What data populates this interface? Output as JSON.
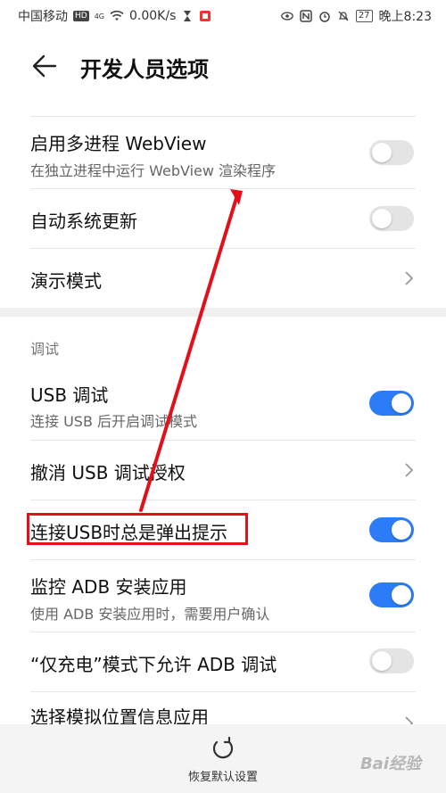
{
  "status_bar": {
    "carrier": "中国移动",
    "hd": "HD",
    "signal": "4G",
    "speed": "0.00K/s",
    "battery": "27",
    "time": "晚上8:23"
  },
  "header": {
    "title": "开发人员选项"
  },
  "items": [
    {
      "title": "启用多进程 WebView",
      "subtitle": "在独立进程中运行 WebView 渲染程序",
      "control": "toggle",
      "on": false
    },
    {
      "title": "自动系统更新",
      "control": "toggle",
      "on": false
    },
    {
      "title": "演示模式",
      "control": "chevron"
    }
  ],
  "debug_section": {
    "title": "调试",
    "items": [
      {
        "title": "USB 调试",
        "subtitle": "连接 USB 后开启调试模式",
        "control": "toggle",
        "on": true
      },
      {
        "title": "撤消 USB 调试授权",
        "control": "chevron"
      },
      {
        "title": "连接USB时总是弹出提示",
        "control": "toggle",
        "on": true
      },
      {
        "title": "监控 ADB 安装应用",
        "subtitle": "使用 ADB 安装应用时，需要用户确认",
        "control": "toggle",
        "on": true
      },
      {
        "title": "“仅充电”模式下允许 ADB 调试",
        "control": "toggle",
        "on": false
      },
      {
        "title": "选择模拟位置信息应用",
        "control": "chevron"
      }
    ]
  },
  "bottom_bar": {
    "reset_label": "恢复默认设置"
  },
  "watermark": "Bai经验",
  "colors": {
    "accent": "#2b7cf6",
    "highlight": "#e3101a"
  },
  "icons": [
    "back-arrow-icon",
    "chevron-right-icon",
    "reset-icon",
    "wifi-icon"
  ]
}
